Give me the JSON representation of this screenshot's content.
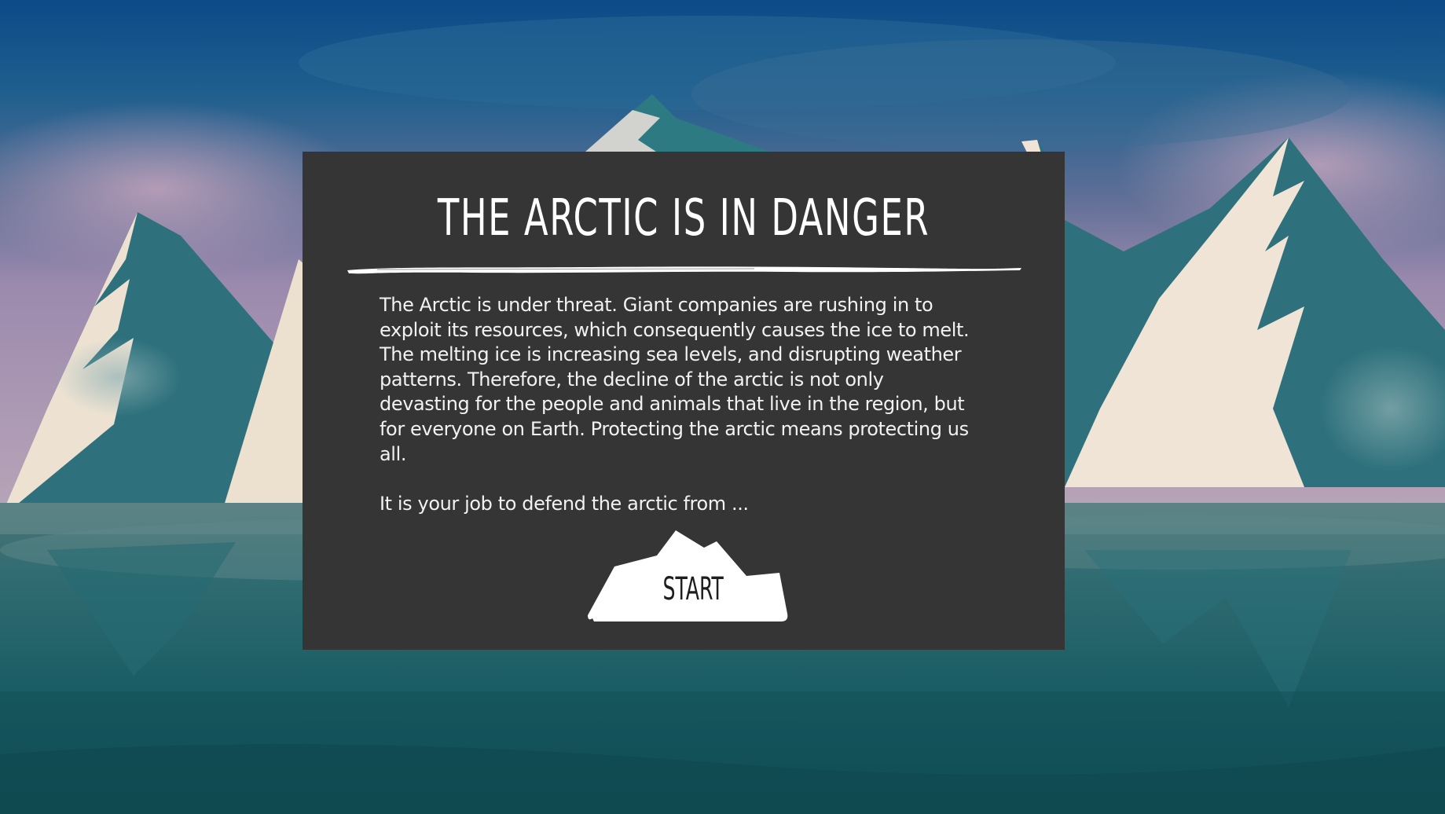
{
  "background": {
    "sky_top": "#0e4a86",
    "sky_mid": "#6a6a98",
    "sky_glow": "#c3a6b7",
    "mountain_teal": "#2f7580",
    "snow": "#efe4d3",
    "water_top": "#3c6c70",
    "water_bottom": "#0f4f55"
  },
  "panel": {
    "title": "THE ARCTIC IS IN DANGER",
    "paragraphs": [
      "The Arctic is under threat. Giant companies are rushing in to exploit its resources, which consequently causes the ice to melt. The melting ice is increasing sea levels, and disrupting weather patterns. Therefore, the decline of the arctic is not only devasting for the people and animals that live in the region, but for everyone on Earth. Protecting the arctic means protecting us all.",
      "It is your job to defend the arctic from ..."
    ],
    "start_label": "START",
    "background_color": "#353535"
  }
}
